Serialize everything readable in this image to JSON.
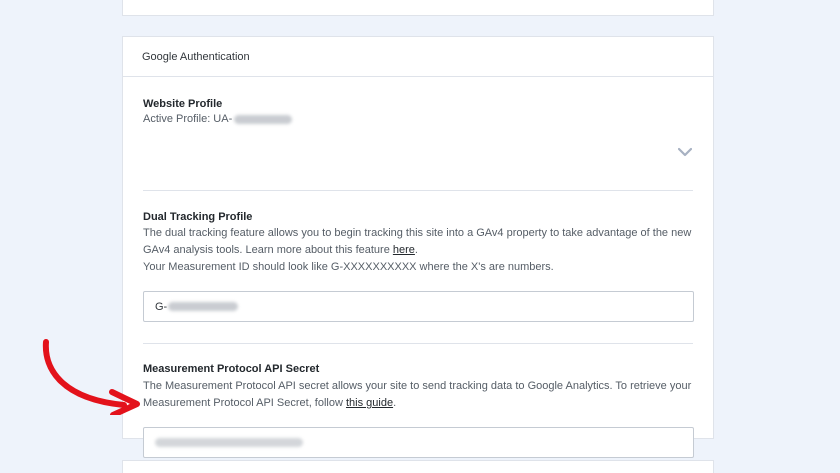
{
  "header": {
    "title": "Google Authentication"
  },
  "website_profile": {
    "title": "Website Profile",
    "active_label": "Active Profile: UA-"
  },
  "dual_tracking": {
    "title": "Dual Tracking Profile",
    "description_1": "The dual tracking feature allows you to begin tracking this site into a GAv4 property to take advantage of the new GAv4 analysis tools. Learn more about this feature ",
    "link_text": "here",
    "description_end": ".",
    "description_2": "Your Measurement ID should look like G-XXXXXXXXXX where the X's are numbers.",
    "input_prefix": "G-"
  },
  "api_secret": {
    "title": "Measurement Protocol API Secret",
    "description": "The Measurement Protocol API secret allows your site to send tracking data to Google Analytics. To retrieve your Measurement Protocol API Secret, follow ",
    "link_text": "this guide",
    "description_end": "."
  },
  "colors": {
    "background": "#eef3fb",
    "card": "#ffffff",
    "border": "#dfe3ea",
    "arrow": "#e3121b",
    "chevron": "#a7b1c2"
  },
  "icons": {
    "chevron": "chevron-down-icon",
    "arrow": "red-curved-arrow-icon"
  }
}
